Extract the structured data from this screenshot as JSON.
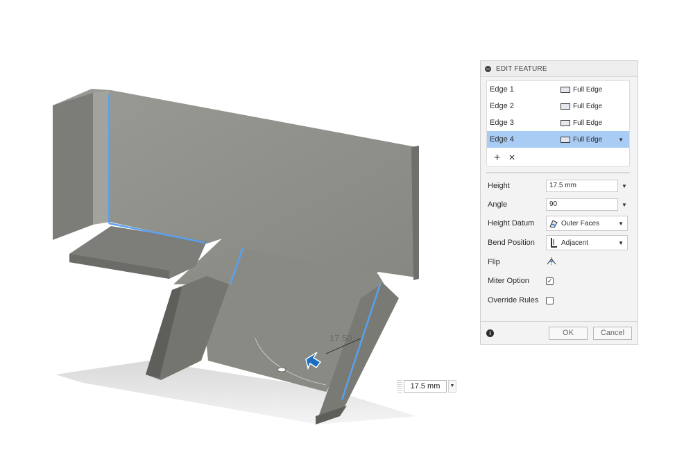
{
  "viewport": {
    "dimension_label": "17.50",
    "dimension_input": {
      "value": "17.5 mm"
    }
  },
  "panel": {
    "title": "EDIT FEATURE",
    "edges": [
      {
        "name": "Edge 1",
        "type": "Full Edge",
        "selected": false
      },
      {
        "name": "Edge 2",
        "type": "Full Edge",
        "selected": false
      },
      {
        "name": "Edge 3",
        "type": "Full Edge",
        "selected": false
      },
      {
        "name": "Edge 4",
        "type": "Full Edge",
        "selected": true
      }
    ],
    "add_symbol": "+",
    "remove_symbol": "×",
    "properties": {
      "height": {
        "label": "Height",
        "value": "17.5 mm"
      },
      "angle": {
        "label": "Angle",
        "value": "90"
      },
      "height_datum": {
        "label": "Height Datum",
        "value": "Outer Faces",
        "icon": "outer-faces-icon"
      },
      "bend_position": {
        "label": "Bend Position",
        "value": "Adjacent",
        "icon": "adjacent-icon"
      },
      "flip": {
        "label": "Flip",
        "icon": "flip-icon"
      },
      "miter_option": {
        "label": "Miter Option",
        "checked": true
      },
      "override_rules": {
        "label": "Override Rules",
        "checked": false
      }
    },
    "ok_label": "OK",
    "cancel_label": "Cancel"
  },
  "colors": {
    "selection_blue": "#a9ccf5",
    "edge_highlight": "#5aa0ee",
    "model_gray": "#8f8f8a",
    "manipulator_blue": "#1b6ec2"
  }
}
